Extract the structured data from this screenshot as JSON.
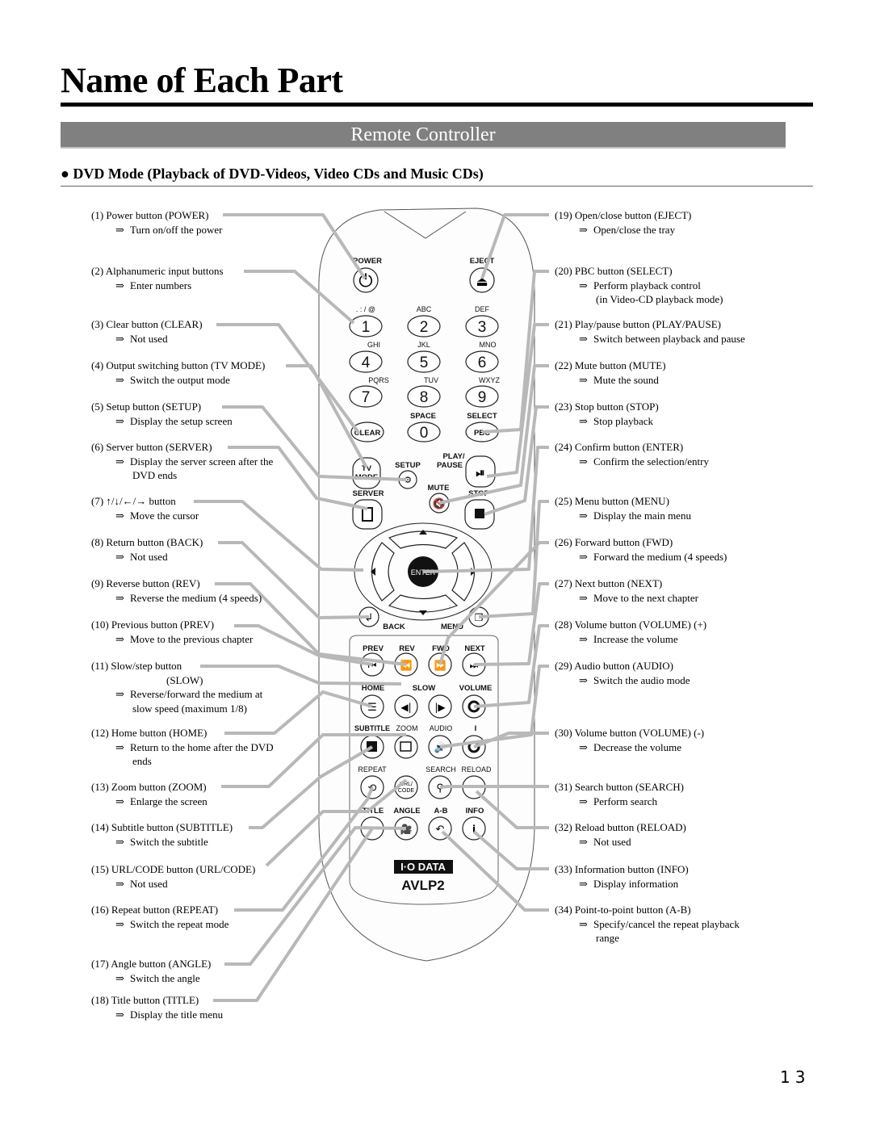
{
  "page": {
    "title": "Name of Each Part",
    "section": "Remote Controller",
    "subsection": "● DVD Mode (Playback of DVD-Videos, Video CDs and Music CDs)",
    "page_number": "13"
  },
  "arrow_symbol": "⇒",
  "left_items": [
    {
      "label": "(1) Power button (POWER)",
      "desc": [
        "Turn on/off the power"
      ]
    },
    {
      "label": "(2) Alphanumeric input buttons",
      "desc": [
        "Enter numbers"
      ]
    },
    {
      "label": "(3) Clear button (CLEAR)",
      "desc": [
        "Not used"
      ]
    },
    {
      "label": "(4) Output switching button (TV MODE)",
      "desc": [
        "Switch the output mode"
      ]
    },
    {
      "label": "(5) Setup button (SETUP)",
      "desc": [
        "Display the setup screen"
      ]
    },
    {
      "label": "(6) Server button (SERVER)",
      "desc": [
        "Display the server screen after the",
        "DVD ends"
      ]
    },
    {
      "label": "(7) ↑/↓/←/→ button",
      "desc": [
        "Move the cursor"
      ]
    },
    {
      "label": "(8) Return button (BACK)",
      "desc": [
        "Not used"
      ]
    },
    {
      "label": "(9) Reverse button (REV)",
      "desc": [
        "Reverse the medium (4 speeds)"
      ]
    },
    {
      "label": "(10) Previous button (PREV)",
      "desc": [
        "Move to the previous chapter"
      ]
    },
    {
      "label": "(11) Slow/step button",
      "label2": "(SLOW)",
      "desc": [
        "Reverse/forward the medium at",
        "slow speed (maximum 1/8)"
      ]
    },
    {
      "label": "(12) Home button (HOME)",
      "desc": [
        "Return to the home after the DVD",
        "ends"
      ]
    },
    {
      "label": "(13) Zoom button (ZOOM)",
      "desc": [
        "Enlarge the screen"
      ]
    },
    {
      "label": "(14) Subtitle button (SUBTITLE)",
      "desc": [
        "Switch the subtitle"
      ]
    },
    {
      "label": "(15) URL/CODE button (URL/CODE)",
      "desc": [
        "Not used"
      ]
    },
    {
      "label": "(16) Repeat button (REPEAT)",
      "desc": [
        "Switch the repeat mode"
      ]
    },
    {
      "label": "(17) Angle button (ANGLE)",
      "desc": [
        "Switch the angle"
      ]
    },
    {
      "label": "(18) Title button (TITLE)",
      "desc": [
        "Display the title menu"
      ]
    }
  ],
  "right_items": [
    {
      "label": "(19) Open/close button (EJECT)",
      "desc": [
        "Open/close the tray"
      ]
    },
    {
      "label": "(20) PBC button (SELECT)",
      "desc": [
        "Perform playback control",
        "(in Video-CD playback mode)"
      ]
    },
    {
      "label": "(21) Play/pause button (PLAY/PAUSE)",
      "desc": [
        "Switch between playback and pause"
      ]
    },
    {
      "label": "(22) Mute button (MUTE)",
      "desc": [
        "Mute the sound"
      ]
    },
    {
      "label": "(23) Stop button (STOP)",
      "desc": [
        "Stop playback"
      ]
    },
    {
      "label": "(24) Confirm button (ENTER)",
      "desc": [
        "Confirm the selection/entry"
      ]
    },
    {
      "label": "(25) Menu button (MENU)",
      "desc": [
        "Display the main menu"
      ]
    },
    {
      "label": "(26) Forward button (FWD)",
      "desc": [
        "Forward the medium (4 speeds)"
      ]
    },
    {
      "label": "(27) Next button (NEXT)",
      "desc": [
        "Move to the next chapter"
      ]
    },
    {
      "label": "(28) Volume button (VOLUME) (+)",
      "desc": [
        "Increase the volume"
      ]
    },
    {
      "label": "(29) Audio button (AUDIO)",
      "desc": [
        "Switch the audio mode"
      ]
    },
    {
      "label": "(30) Volume button (VOLUME) (-)",
      "desc": [
        "Decrease the volume"
      ]
    },
    {
      "label": "(31) Search button (SEARCH)",
      "desc": [
        "Perform search"
      ]
    },
    {
      "label": "(32) Reload button (RELOAD)",
      "desc": [
        "Not used"
      ]
    },
    {
      "label": "(33) Information button (INFO)",
      "desc": [
        "Display information"
      ]
    },
    {
      "label": "(34) Point-to-point button (A-B)",
      "desc": [
        "Specify/cancel the repeat playback",
        "range"
      ]
    }
  ],
  "remote": {
    "labels": {
      "power": "POWER",
      "eject": "EJECT",
      "k1_sub": ". : / @",
      "k2_sub": "ABC",
      "k3_sub": "DEF",
      "k4_sub": "GHI",
      "k5_sub": "JKL",
      "k6_sub": "MNO",
      "k7_sub": "PQRS",
      "k8_sub": "TUV",
      "k9_sub": "WXYZ",
      "k1": "1",
      "k2": "2",
      "k3": "3",
      "k4": "4",
      "k5": "5",
      "k6": "6",
      "k7": "7",
      "k8": "8",
      "k9": "9",
      "k0": "0",
      "space": "SPACE",
      "select": "SELECT",
      "clear": "CLEAR",
      "pbc": "PBC",
      "tv": "TV",
      "mode": "MODE",
      "setup": "SETUP",
      "play": "PLAY/",
      "pause": "PAUSE",
      "server": "SERVER",
      "mute": "MUTE",
      "stop": "STOP",
      "enter": "ENTER",
      "back": "BACK",
      "menu": "MENU",
      "prev": "PREV",
      "rev": "REV",
      "fwd": "FWD",
      "next": "NEXT",
      "home": "HOME",
      "slow": "SLOW",
      "volume": "VOLUME",
      "subtitle": "SUBTITLE",
      "zoom": "ZOOM",
      "audio": "AUDIO",
      "vol_minus_mark": "I",
      "repeat": "REPEAT",
      "url": "URL/",
      "code": "CODE",
      "search": "SEARCH",
      "reload": "RELOAD",
      "title": "TITLE",
      "angle": "ANGLE",
      "ab": "A-B",
      "info": "INFO",
      "brand": "I·O DATA",
      "model": "AVLP2"
    }
  }
}
